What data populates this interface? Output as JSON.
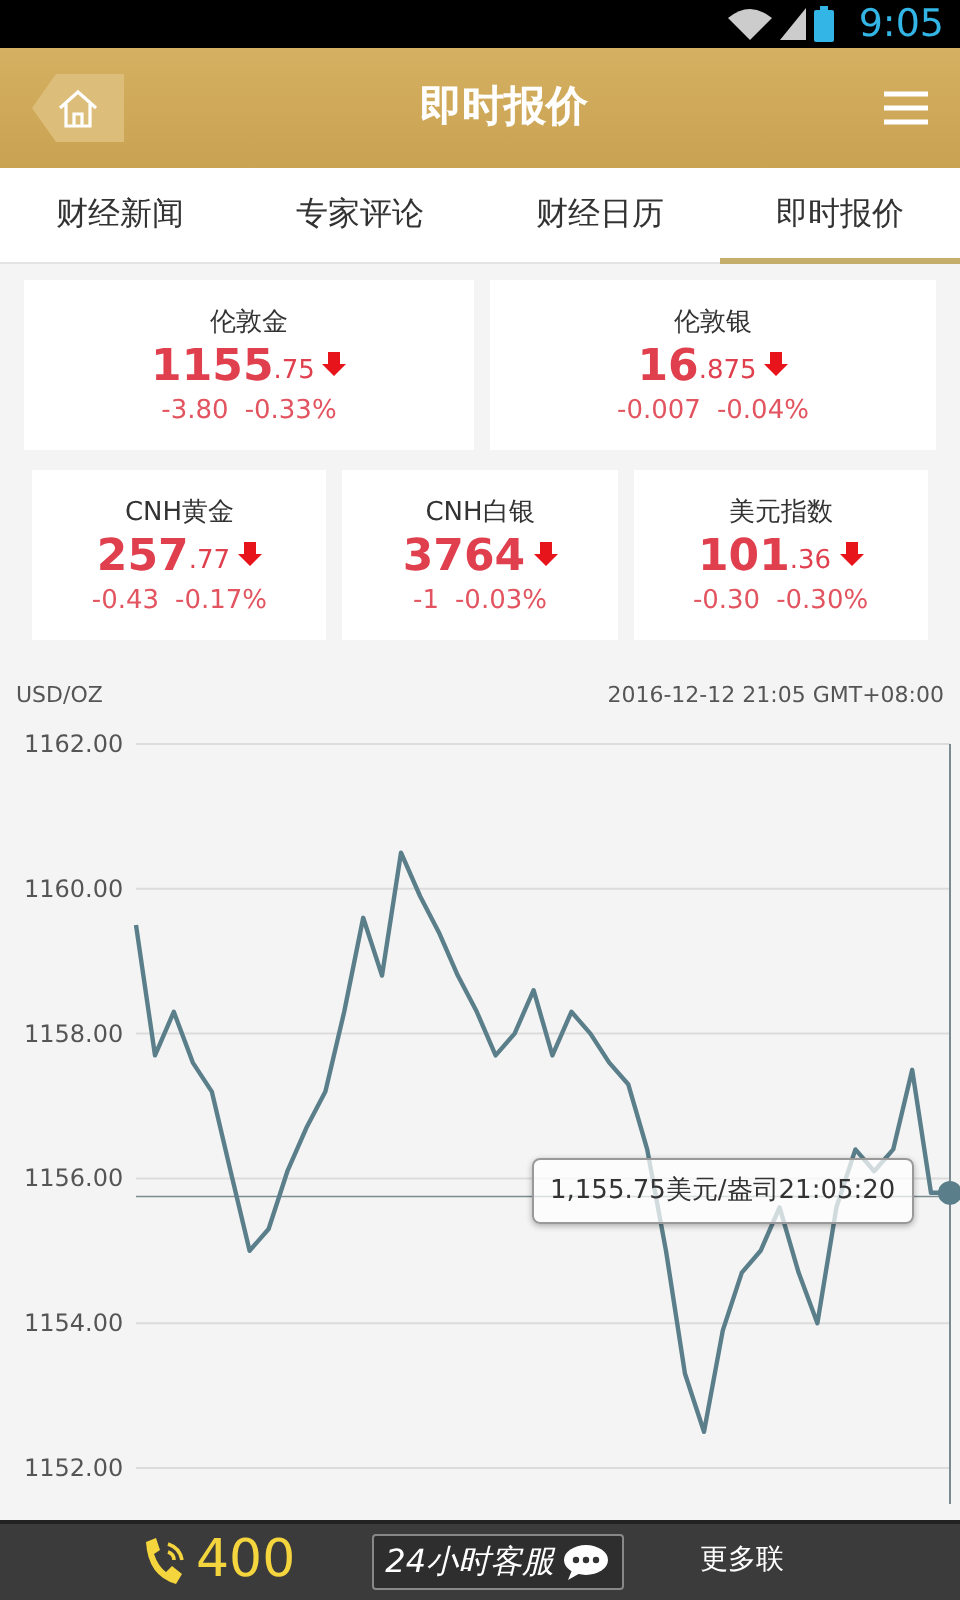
{
  "status_bar": {
    "time": "9:05"
  },
  "header": {
    "title": "即时报价"
  },
  "tabs": [
    {
      "label": "财经新闻",
      "selected": false
    },
    {
      "label": "专家评论",
      "selected": false
    },
    {
      "label": "财经日历",
      "selected": false
    },
    {
      "label": "即时报价",
      "selected": true
    }
  ],
  "quotes": [
    {
      "name": "伦敦金",
      "price_integer": "1155",
      "price_decimal": ".75",
      "change": "-3.80",
      "change_percent": "-0.33%",
      "falling": true
    },
    {
      "name": "伦敦银",
      "price_integer": "16",
      "price_decimal": ".875",
      "change": "-0.007",
      "change_percent": "-0.04%",
      "falling": true
    },
    {
      "name": "CNH黄金",
      "price_integer": "257",
      "price_decimal": ".77",
      "change": "-0.43",
      "change_percent": "-0.17%",
      "falling": true
    },
    {
      "name": "CNH白银",
      "price_integer": "3764",
      "change": "-1",
      "change_percent": "-0.03%",
      "falling": true
    },
    {
      "name": "美元指数",
      "price_integer": "101",
      "price_decimal": ".36",
      "change": "-0.30",
      "change_percent": "-0.30%",
      "falling": true
    }
  ],
  "chart": {
    "unit": "USD/OZ",
    "timestamp": "2016-12-12 21:05 GMT+08:00",
    "tooltip": "1,155.75美元/盎司21:05:20",
    "chart_data": {
      "type": "line",
      "grid": true,
      "ref_lines": [
        {
          "axis": "y",
          "value": 1155.75
        }
      ],
      "ylim": [
        1152,
        1162
      ],
      "yticks": [
        {
          "value": 1152,
          "label": "1152.00"
        },
        {
          "value": 1154,
          "label": "1154.00"
        },
        {
          "value": 1156,
          "label": "1156.00"
        },
        {
          "value": 1158,
          "label": "1158.00"
        },
        {
          "value": 1160,
          "label": "1160.00"
        },
        {
          "value": 1162,
          "label": "1162.00"
        }
      ],
      "series": [
        {
          "color": "#5b7f8a",
          "values": [
            1159.5,
            1157.7,
            1158.3,
            1157.6,
            1157.2,
            1156.1,
            1155.0,
            1155.3,
            1156.1,
            1156.7,
            1157.2,
            1158.3,
            1159.6,
            1158.8,
            1160.5,
            1159.9,
            1159.4,
            1158.8,
            1158.3,
            1157.7,
            1158.0,
            1158.6,
            1157.7,
            1158.3,
            1158.0,
            1157.6,
            1157.3,
            1156.4,
            1155.0,
            1153.3,
            1152.5,
            1153.9,
            1154.7,
            1155.0,
            1155.6,
            1154.7,
            1154.0,
            1155.6,
            1156.4,
            1156.1,
            1156.4,
            1157.5,
            1155.8,
            1155.8
          ]
        }
      ]
    }
  },
  "footer": {
    "phone": "400",
    "service_button": "24小时客服",
    "more": "更多联"
  }
}
